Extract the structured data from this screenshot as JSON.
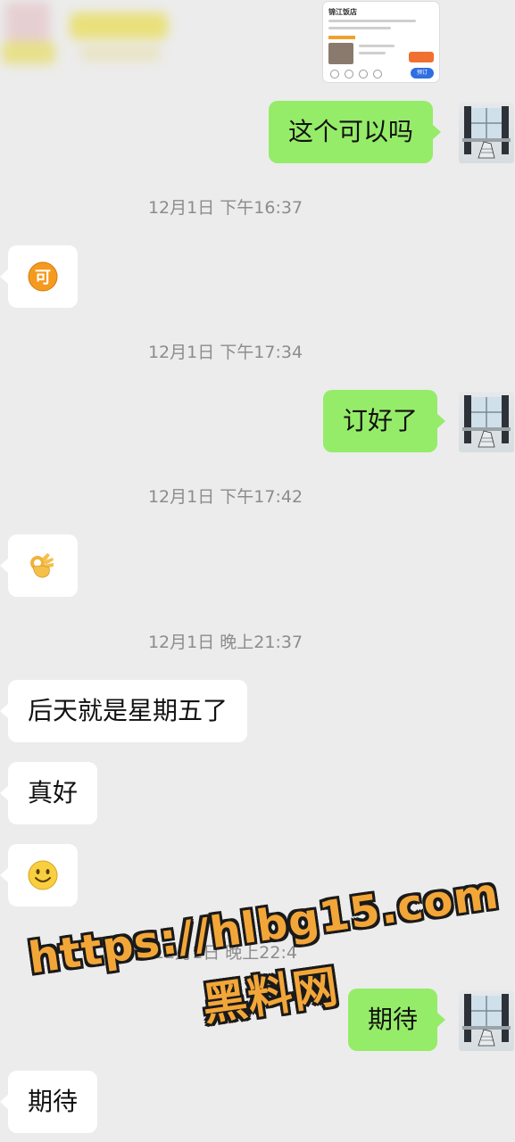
{
  "shared_card": {
    "title": "锦江饭店",
    "button": "预订"
  },
  "messages": [
    {
      "id": "m1",
      "from": "me",
      "text": "这个可以吗"
    },
    {
      "id": "t1",
      "type": "time",
      "text": "12月1日 下午16:37"
    },
    {
      "id": "m2",
      "from": "them",
      "emoji": "ke-sticker",
      "text": "可"
    },
    {
      "id": "t2",
      "type": "time",
      "text": "12月1日 下午17:34"
    },
    {
      "id": "m3",
      "from": "me",
      "text": "订好了"
    },
    {
      "id": "t3",
      "type": "time",
      "text": "12月1日 下午17:42"
    },
    {
      "id": "m4",
      "from": "them",
      "emoji": "ok-hand-emoji"
    },
    {
      "id": "t4",
      "type": "time",
      "text": "12月1日 晚上21:37"
    },
    {
      "id": "m5",
      "from": "them",
      "text": "后天就是星期五了"
    },
    {
      "id": "m6",
      "from": "them",
      "text": "真好"
    },
    {
      "id": "m7",
      "from": "them",
      "emoji": "smile-emoji"
    },
    {
      "id": "t5",
      "type": "time",
      "text": "12月1日 晚上22:4"
    },
    {
      "id": "m8",
      "from": "me",
      "text": "期待"
    },
    {
      "id": "m9",
      "from": "them",
      "text": "期待"
    }
  ],
  "watermark": {
    "line1": "https://hlbg15.com",
    "line2": "黑料网"
  },
  "colors": {
    "background": "#ececec",
    "self_bubble": "#95ec69",
    "other_bubble": "#ffffff",
    "timestamp": "#8c8c8c",
    "watermark": "#f3a638"
  }
}
